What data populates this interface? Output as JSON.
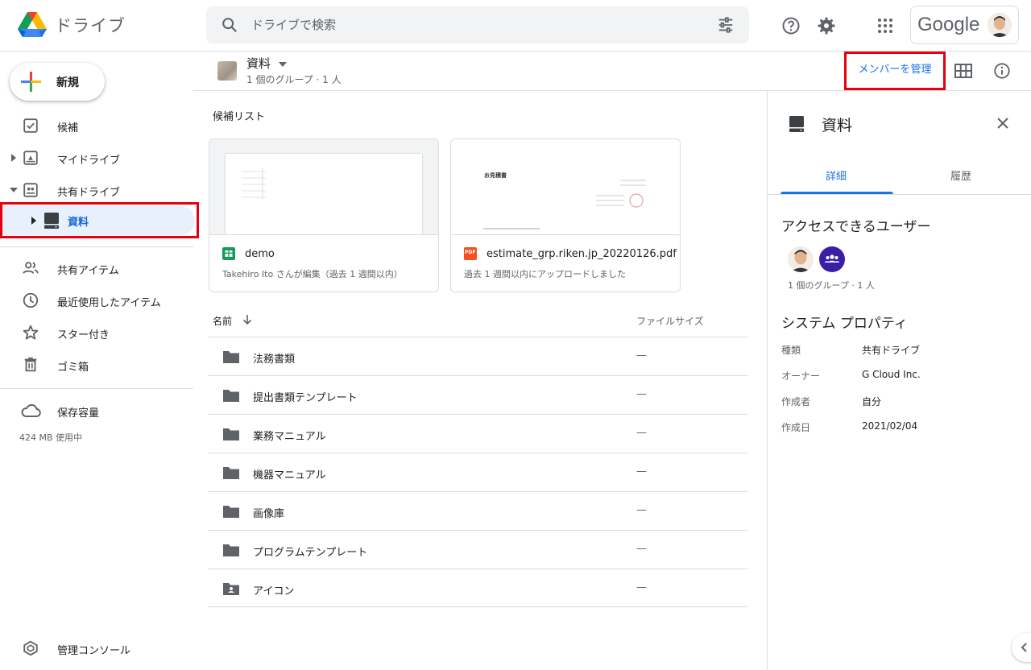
{
  "header": {
    "app_title": "ドライブ",
    "search_placeholder": "ドライブで検索",
    "account_brand": "Google"
  },
  "sidebar": {
    "new_label": "新規",
    "items": [
      {
        "label": "候補"
      },
      {
        "label": "マイドライブ"
      },
      {
        "label": "共有ドライブ"
      },
      {
        "label": "資料"
      },
      {
        "label": "共有アイテム"
      },
      {
        "label": "最近使用したアイテム"
      },
      {
        "label": "スター付き"
      },
      {
        "label": "ゴミ箱"
      },
      {
        "label": "保存容量"
      },
      {
        "label": "管理コンソール"
      }
    ],
    "storage_used": "424 MB 使用中"
  },
  "toolbar": {
    "drive_name": "資料",
    "drive_members": "1 個のグループ · 1 人",
    "manage_members_label": "メンバーを管理"
  },
  "main": {
    "suggested_title": "候補リスト",
    "cards": [
      {
        "name": "demo",
        "subtitle": "Takehiro Ito さんが編集（過去 1 週間以内）",
        "type_icon": "sheets-icon"
      },
      {
        "name": "estimate_grp.riken.jp_20220126.pdf",
        "subtitle": "過去 1 週間以内にアップロードしました",
        "type_icon": "pdf-icon",
        "type_badge": "PDF",
        "preview_heading": "お見積書"
      }
    ],
    "columns": {
      "name": "名前",
      "size": "ファイルサイズ"
    },
    "rows": [
      {
        "name": "法務書類",
        "size": "—"
      },
      {
        "name": "提出書類テンプレート",
        "size": "—"
      },
      {
        "name": "業務マニュアル",
        "size": "—"
      },
      {
        "name": "機器マニュアル",
        "size": "—"
      },
      {
        "name": "画像庫",
        "size": "—"
      },
      {
        "name": "プログラムテンプレート",
        "size": "—"
      },
      {
        "name": "アイコン",
        "size": "—"
      }
    ]
  },
  "details": {
    "title": "資料",
    "tabs": [
      {
        "label": "詳細"
      },
      {
        "label": "履歴"
      }
    ],
    "access_title": "アクセスできるユーザー",
    "access_count": "1 個のグループ · 1 人",
    "properties_title": "システム プロパティ",
    "properties": [
      {
        "key": "種類",
        "value": "共有ドライブ"
      },
      {
        "key": "オーナー",
        "value": "G Cloud Inc."
      },
      {
        "key": "作成者",
        "value": "自分"
      },
      {
        "key": "作成日",
        "value": "2021/02/04"
      }
    ]
  },
  "colors": {
    "accent": "#1a73e8",
    "highlight_box": "#e4000f",
    "selected_bg": "#e8f0fe"
  }
}
